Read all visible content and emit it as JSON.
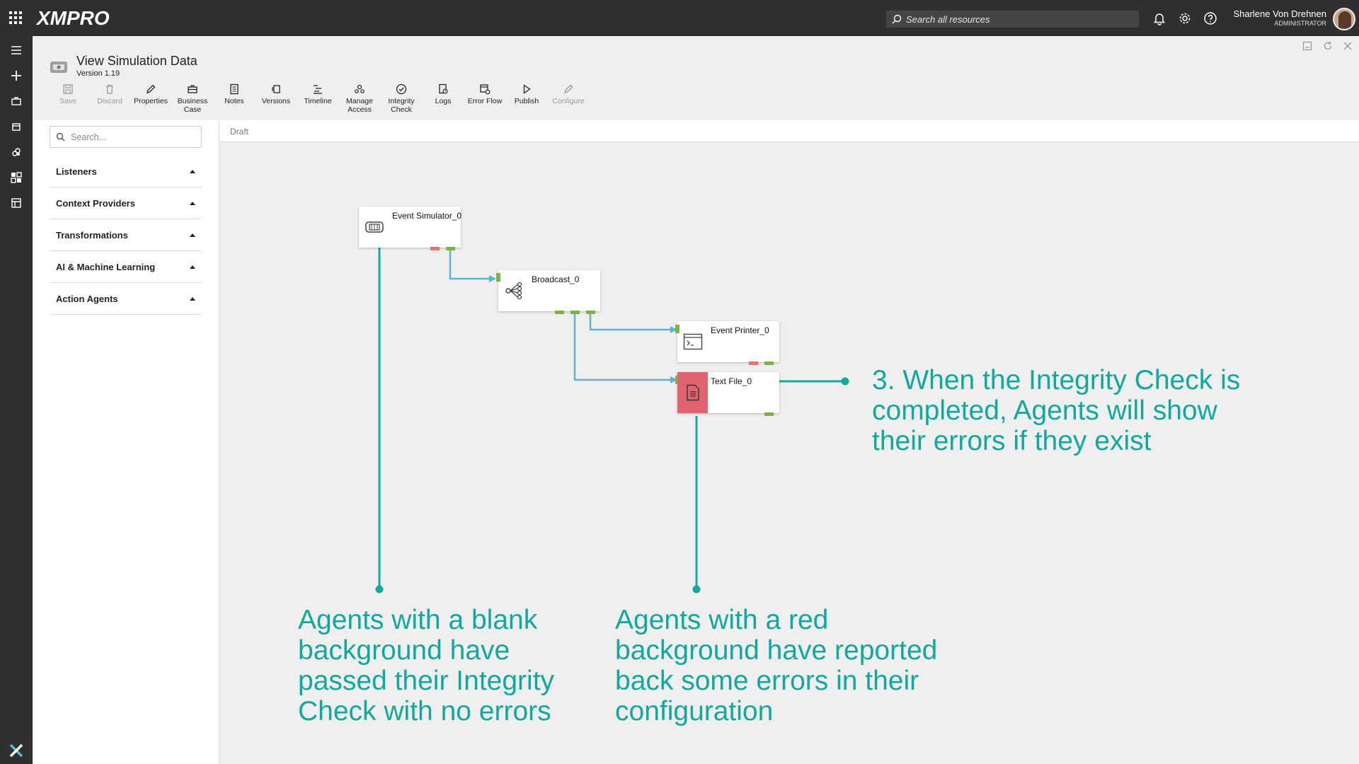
{
  "header": {
    "logo_text": "XMPRO",
    "search_placeholder": "Search all resources",
    "user_name": "Sharlene Von Drehnen",
    "user_role": "ADMINISTRATOR"
  },
  "page": {
    "title": "View Simulation Data",
    "version": "Version 1.19"
  },
  "toolbar": {
    "save": "Save",
    "discard": "Discard",
    "properties": "Properties",
    "business_case_1": "Business",
    "business_case_2": "Case",
    "notes": "Notes",
    "versions": "Versions",
    "timeline": "Timeline",
    "manage_access_1": "Manage",
    "manage_access_2": "Access",
    "integrity_check_1": "Integrity",
    "integrity_check_2": "Check",
    "logs": "Logs",
    "error_flow": "Error Flow",
    "publish": "Publish",
    "configure": "Configure"
  },
  "sidebar": {
    "search_placeholder": "Search...",
    "categories": [
      "Listeners",
      "Context Providers",
      "Transformations",
      "AI & Machine Learning",
      "Action Agents"
    ]
  },
  "canvas": {
    "status": "Draft",
    "agents": {
      "event_simulator": "Event Simulator_0",
      "broadcast": "Broadcast_0",
      "event_printer": "Event Printer_0",
      "text_file": "Text File_0"
    }
  },
  "annotations": {
    "integrity": "3. When the Integrity Check is\ncompleted, Agents will show\ntheir errors if they exist",
    "blank": "Agents with a blank\nbackground have\npassed their Integrity\nCheck with no errors",
    "red": "Agents with a red\nbackground have reported\nback some errors in their\nconfiguration"
  },
  "colors": {
    "topbar": "#2f2f2f",
    "annotation": "#13a89e",
    "connector": "#5bb3d6",
    "error_agent": "#e06470",
    "port_ok": "#7cb342",
    "port_error": "#e57373"
  }
}
